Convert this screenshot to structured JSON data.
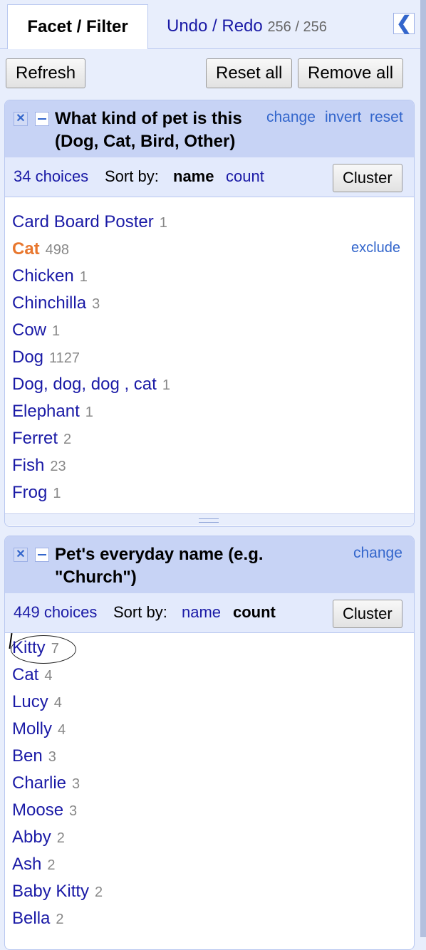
{
  "tabs": {
    "facet_filter": "Facet / Filter",
    "undo_redo": "Undo / Redo",
    "undo_count": "256 / 256"
  },
  "toolbar": {
    "refresh": "Refresh",
    "reset_all": "Reset all",
    "remove_all": "Remove all"
  },
  "facet1": {
    "title_line1": "What kind of pet is this",
    "title_line2": "(Dog, Cat, Bird, Other)",
    "change": "change",
    "invert": "invert",
    "reset": "reset",
    "choices": "34 choices",
    "sort_by": "Sort by:",
    "sort_name": "name",
    "sort_count": "count",
    "cluster": "Cluster",
    "exclude": "exclude",
    "items": [
      {
        "name": "Card Board Poster",
        "count": "1"
      },
      {
        "name": "Cat",
        "count": "498"
      },
      {
        "name": "Chicken",
        "count": "1"
      },
      {
        "name": "Chinchilla",
        "count": "3"
      },
      {
        "name": "Cow",
        "count": "1"
      },
      {
        "name": "Dog",
        "count": "1127"
      },
      {
        "name": "Dog, dog, dog , cat",
        "count": "1"
      },
      {
        "name": "Elephant",
        "count": "1"
      },
      {
        "name": "Ferret",
        "count": "2"
      },
      {
        "name": "Fish",
        "count": "23"
      },
      {
        "name": "Frog",
        "count": "1"
      }
    ]
  },
  "facet2": {
    "title_line1": "Pet's everyday name (e.g.",
    "title_line2": "\"Church\")",
    "change": "change",
    "choices": "449 choices",
    "sort_by": "Sort by:",
    "sort_name": "name",
    "sort_count": "count",
    "cluster": "Cluster",
    "items": [
      {
        "name": "Kitty",
        "count": "7"
      },
      {
        "name": "Cat",
        "count": "4"
      },
      {
        "name": "Lucy",
        "count": "4"
      },
      {
        "name": "Molly",
        "count": "4"
      },
      {
        "name": "Ben",
        "count": "3"
      },
      {
        "name": "Charlie",
        "count": "3"
      },
      {
        "name": "Moose",
        "count": "3"
      },
      {
        "name": "Abby",
        "count": "2"
      },
      {
        "name": "Ash",
        "count": "2"
      },
      {
        "name": "Baby Kitty",
        "count": "2"
      },
      {
        "name": "Bella",
        "count": "2"
      }
    ]
  }
}
